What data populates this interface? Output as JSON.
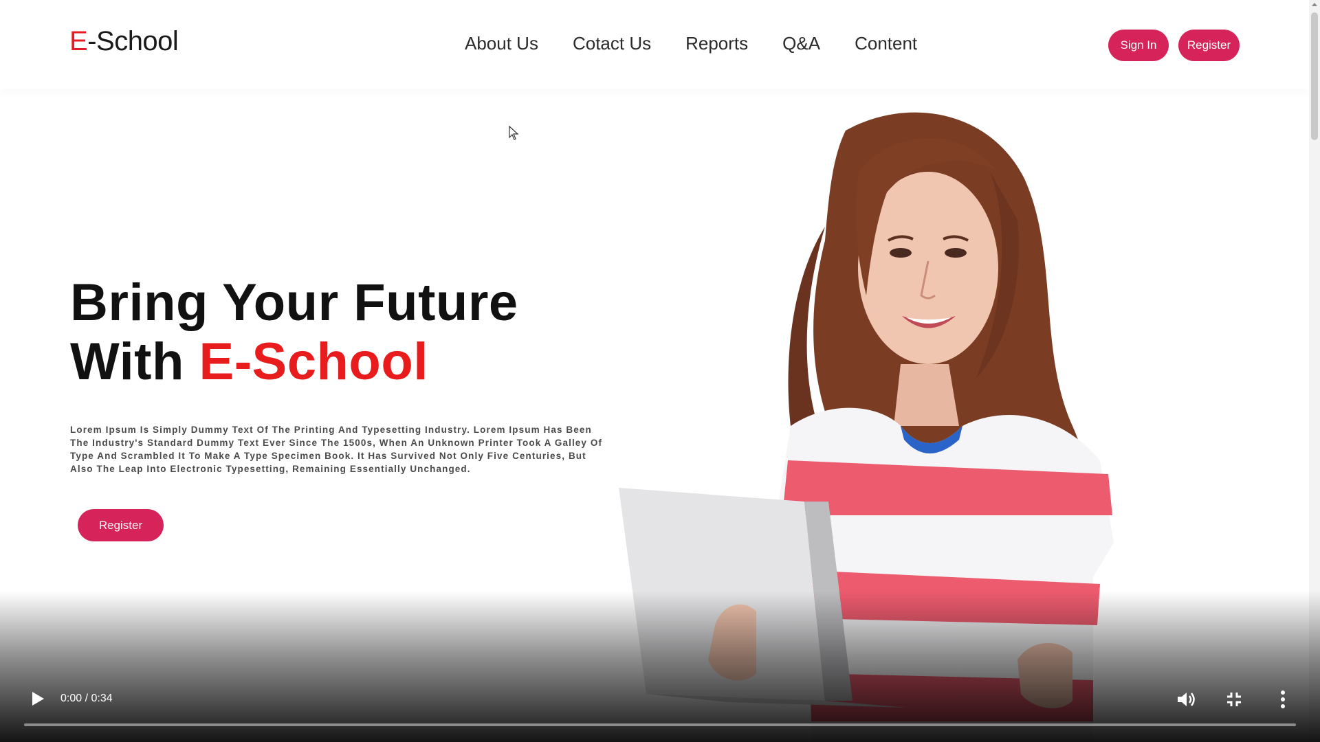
{
  "header": {
    "logo_prefix": "E",
    "logo_suffix": "-School",
    "nav": [
      {
        "label": "About Us"
      },
      {
        "label": "Cotact Us"
      },
      {
        "label": "Reports"
      },
      {
        "label": "Q&A"
      },
      {
        "label": "Content"
      }
    ],
    "signin_label": "Sign In",
    "register_label": "Register"
  },
  "hero": {
    "title_line1": "Bring Your Future",
    "title_line2_prefix": "With ",
    "title_line2_accent": "E-School",
    "body": "Lorem Ipsum Is Simply Dummy Text Of The Printing And Typesetting Industry. Lorem Ipsum Has Been The Industry's Standard Dummy Text Ever Since The 1500s, When An Unknown Printer Took A Galley Of Type And Scrambled It To Make A Type Specimen Book. It Has Survived Not Only Five Centuries, But Also The Leap Into Electronic Typesetting, Remaining Essentially Unchanged.",
    "register_label": "Register"
  },
  "video_controls": {
    "time": "0:00 / 0:34",
    "progress": 0.0
  },
  "colors": {
    "accent_red": "#e61b23",
    "button_pink": "#d6245a"
  },
  "icons": {
    "play": "play-icon",
    "volume": "volume-icon",
    "fullscreen": "exit-fullscreen-icon",
    "more": "more-vert-icon"
  }
}
